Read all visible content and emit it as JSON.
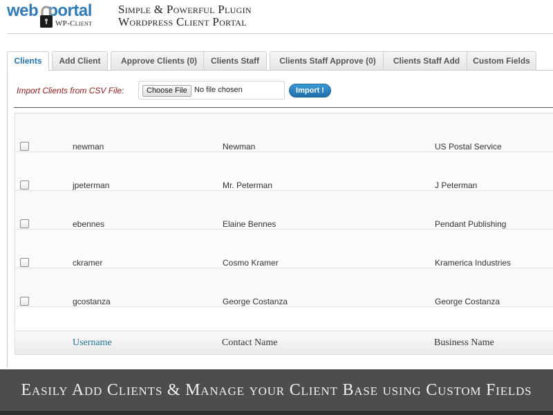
{
  "header": {
    "logo": {
      "part1": "web",
      "part2": "portal",
      "sub": "WP-Client"
    },
    "tagline_line1": "Simple & Powerful Plugin",
    "tagline_line2": "Wordpress Client Portal"
  },
  "tabs": [
    {
      "label": "Clients",
      "active": true
    },
    {
      "label": "Add Client",
      "active": false
    },
    {
      "label": "Approve Clients (0)",
      "active": false
    },
    {
      "label": "Clients Staff",
      "active": false
    },
    {
      "label": "Clients Staff Approve (0)",
      "active": false
    },
    {
      "label": "Clients Staff Add",
      "active": false
    },
    {
      "label": "Custom Fields",
      "active": false
    }
  ],
  "import": {
    "label": "Import Clients from CSV File:",
    "choose_file": "Choose File",
    "no_file": "No file chosen",
    "button": "Import !"
  },
  "table": {
    "columns": [
      "Username",
      "Contact Name",
      "Business Name"
    ],
    "rows": [
      {
        "username": "newman",
        "contact": "Newman",
        "business": "US Postal Service"
      },
      {
        "username": "jpeterman",
        "contact": "Mr. Peterman",
        "business": "J Peterman"
      },
      {
        "username": "ebennes",
        "contact": "Elaine Bennes",
        "business": "Pendant Publishing"
      },
      {
        "username": "ckramer",
        "contact": "Cosmo Kramer",
        "business": "Kramerica Industries"
      },
      {
        "username": "gcostanza",
        "contact": "George Costanza",
        "business": "George Costanza"
      }
    ]
  },
  "banner": {
    "text": "Easily Add Clients & Manage your Client Base using Custom Fields"
  },
  "colors": {
    "brand_blue": "#2f7ab8",
    "active_tab": "#2173b3",
    "import_label": "#8b1a1a",
    "banner_bg": "#4d4d4d"
  },
  "icons": {
    "logo_lock": "padlock-icon"
  }
}
